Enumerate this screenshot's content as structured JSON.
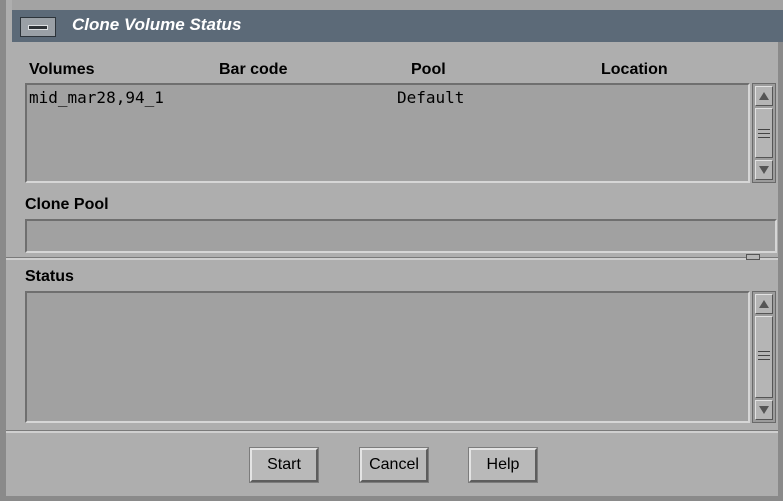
{
  "window": {
    "title": "Clone Volume Status"
  },
  "volumes": {
    "columns": [
      "Volumes",
      "Bar code",
      "Pool",
      "Location"
    ],
    "rows": [
      {
        "volume": "mid_mar28,94_1",
        "barcode": "",
        "pool": "Default",
        "location": ""
      }
    ]
  },
  "clone_pool": {
    "label": "Clone Pool",
    "value": ""
  },
  "status": {
    "label": "Status",
    "value": ""
  },
  "buttons": {
    "start": "Start",
    "cancel": "Cancel",
    "help": "Help"
  }
}
